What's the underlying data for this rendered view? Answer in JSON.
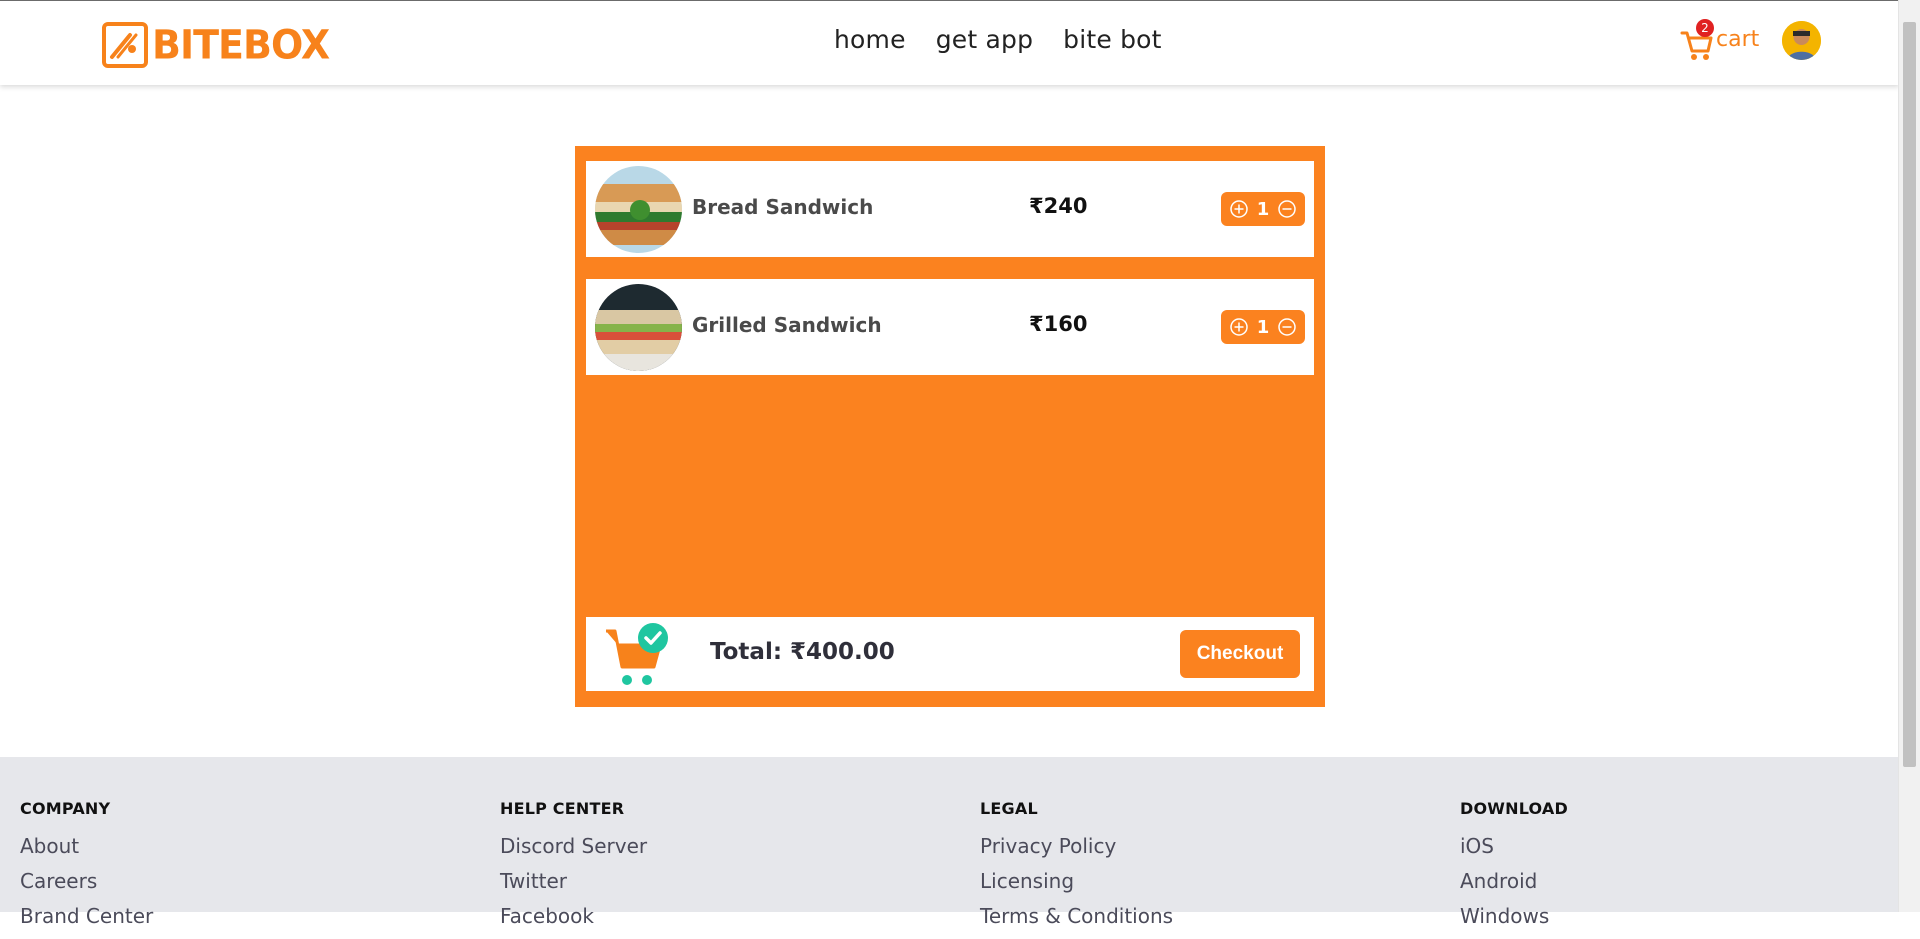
{
  "brand": {
    "name": "BITEBOX",
    "color": "#f7821b"
  },
  "nav": {
    "home": "home",
    "get_app": "get app",
    "bite_bot": "bite bot"
  },
  "cart": {
    "label": "cart",
    "badge": "2"
  },
  "items": [
    {
      "name": "Bread Sandwich",
      "price": "₹240",
      "qty": "1"
    },
    {
      "name": "Grilled Sandwich",
      "price": "₹160",
      "qty": "1"
    }
  ],
  "summary": {
    "total_label": "Total: ₹400.00",
    "checkout": "Checkout"
  },
  "footer": {
    "company": {
      "title": "COMPANY",
      "links": [
        "About",
        "Careers",
        "Brand Center"
      ]
    },
    "help": {
      "title": "HELP CENTER",
      "links": [
        "Discord Server",
        "Twitter",
        "Facebook"
      ]
    },
    "legal": {
      "title": "LEGAL",
      "links": [
        "Privacy Policy",
        "Licensing",
        "Terms & Conditions"
      ]
    },
    "download": {
      "title": "DOWNLOAD",
      "links": [
        "iOS",
        "Android",
        "Windows"
      ]
    }
  },
  "colors": {
    "accent": "#fb821f",
    "footer_bg": "#e6e7eb",
    "badge": "#e02121",
    "check": "#1fc6a0"
  }
}
